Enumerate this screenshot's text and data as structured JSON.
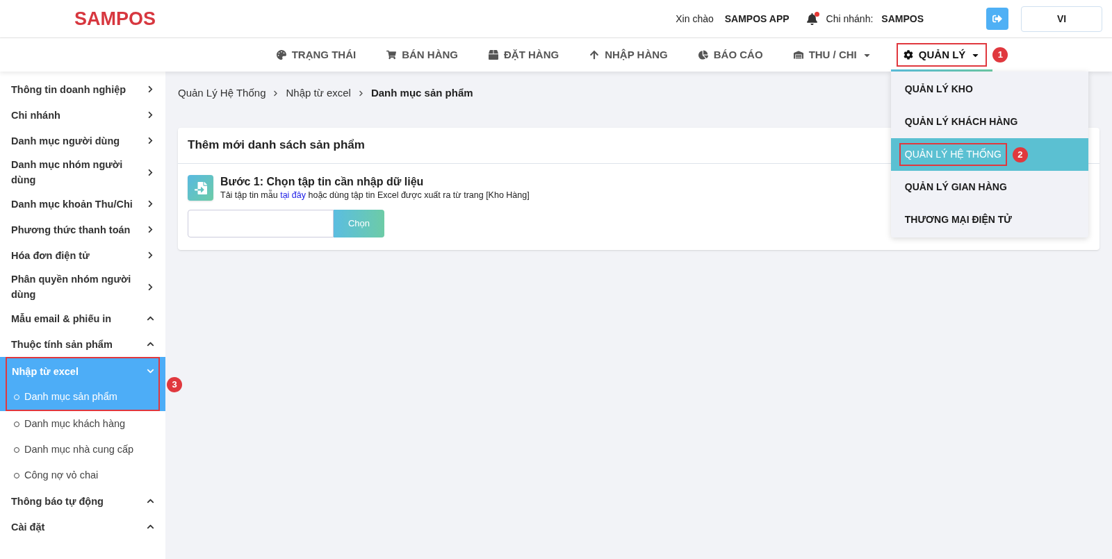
{
  "header": {
    "logo": "SAMPOS",
    "greeting": "Xin chào",
    "user": "SAMPOS APP",
    "branch_label": "Chi nhánh:",
    "branch": "SAMPOS",
    "language": "VI"
  },
  "nav": [
    {
      "label": "TRẠNG THÁI",
      "kind": "palette",
      "dropdown": false,
      "selected": false
    },
    {
      "label": "BÁN HÀNG",
      "kind": "cart",
      "dropdown": false,
      "selected": false
    },
    {
      "label": "ĐẶT HÀNG",
      "kind": "box",
      "dropdown": false,
      "selected": false
    },
    {
      "label": "NHẬP HÀNG",
      "kind": "arrow",
      "dropdown": false,
      "selected": false
    },
    {
      "label": "BÁO CÁO",
      "kind": "pie",
      "dropdown": false,
      "selected": false
    },
    {
      "label": "THU / CHI",
      "kind": "warehouse",
      "dropdown": true,
      "selected": false
    },
    {
      "label": "QUẢN LÝ",
      "kind": "gear",
      "dropdown": true,
      "selected": true,
      "callout": "1"
    }
  ],
  "dropdown_menu": [
    {
      "label": "QUẢN LÝ KHO",
      "selected": false
    },
    {
      "label": "QUẢN LÝ KHÁCH HÀNG",
      "selected": false
    },
    {
      "label": "QUẢN LÝ HỆ THỐNG",
      "selected": true,
      "callout": "2"
    },
    {
      "label": "QUẢN LÝ GIAN HÀNG",
      "selected": false
    },
    {
      "label": "THƯƠNG MẠI ĐIỆN TỬ",
      "selected": false
    }
  ],
  "sidebar": [
    {
      "label": "Thông tin doanh nghiệp",
      "kind": "link"
    },
    {
      "label": "Chi nhánh",
      "kind": "link"
    },
    {
      "label": "Danh mục người dùng",
      "kind": "link"
    },
    {
      "label": "Danh mục nhóm người dùng",
      "kind": "link"
    },
    {
      "label": "Danh mục khoản Thu/Chi",
      "kind": "link"
    },
    {
      "label": "Phương thức thanh toán",
      "kind": "link"
    },
    {
      "label": "Hóa đơn điện tử",
      "kind": "link"
    },
    {
      "label": "Phân quyền nhóm người dùng",
      "kind": "link"
    },
    {
      "label": "Mẫu email & phiếu in",
      "kind": "group",
      "expanded": false
    },
    {
      "label": "Thuộc tính sản phẩm",
      "kind": "group",
      "expanded": false
    },
    {
      "label": "Nhập từ excel",
      "kind": "group",
      "expanded": true,
      "callout": "3",
      "children": [
        {
          "label": "Danh mục sản phẩm",
          "selected": true
        },
        {
          "label": "Danh mục khách hàng",
          "selected": false
        },
        {
          "label": "Danh mục nhà cung cấp",
          "selected": false
        },
        {
          "label": "Công nợ vỏ chai",
          "selected": false
        }
      ]
    },
    {
      "label": "Thông báo tự động",
      "kind": "group",
      "expanded": false
    },
    {
      "label": "Cài đặt",
      "kind": "group",
      "expanded": false
    }
  ],
  "breadcrumb": [
    "Quản Lý Hệ Thống",
    "Nhập từ excel",
    "Danh mục sản phẩm"
  ],
  "card": {
    "title": "Thêm mới danh sách sản phẩm",
    "step_title": "Bước 1: Chọn tập tin cần nhập dữ liệu",
    "step_hint": {
      "before": "Tải tập tin mẫu",
      "link": "tại đây",
      "after": "hoặc dùng tập tin Excel được xuất ra từ trang [Kho Hàng]"
    },
    "choose_button": "Chọn"
  }
}
